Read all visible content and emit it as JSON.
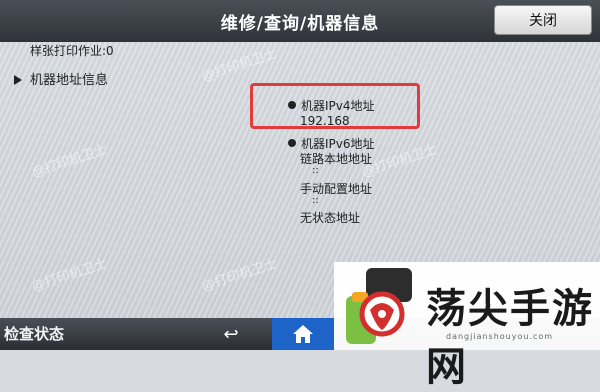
{
  "header": {
    "title": "维修/查询/机器信息",
    "close_label": "关闭"
  },
  "content": {
    "top_partial_text": "样张打印作业:0",
    "section_title": "机器地址信息",
    "ipv4": {
      "label": "机器IPv4地址",
      "value": "192.168"
    },
    "ipv6": {
      "label": "机器IPv6地址",
      "link_local_label": "链路本地地址",
      "link_local_value": "::",
      "manual_label": "手动配置地址",
      "manual_value": "::",
      "stateless_label": "无状态地址"
    },
    "watermark": "@打印机卫士"
  },
  "footer": {
    "status_label": "检查状态",
    "back_icon": "↩",
    "home_icon": "home-icon"
  },
  "logo": {
    "text": "荡尖手游网",
    "sub": "dangjianshouyou.com"
  },
  "colors": {
    "highlight": "#e23b3b",
    "home_button": "#1e63c8"
  }
}
